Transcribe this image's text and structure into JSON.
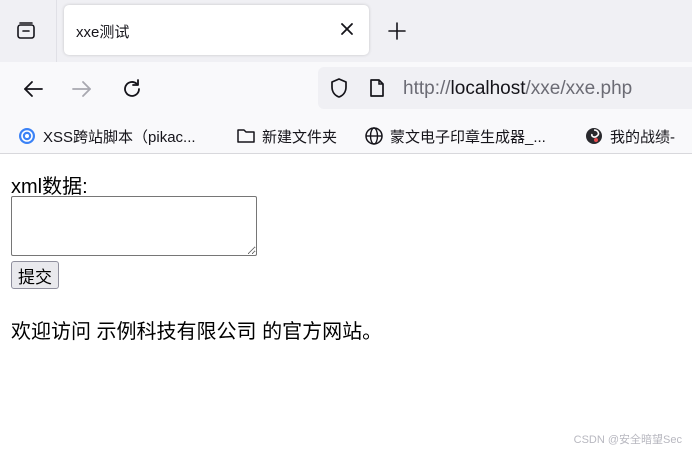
{
  "tab": {
    "title": "xxe测试"
  },
  "address": {
    "scheme": "http://",
    "host": "localhost",
    "path": "/xxe/xxe.php"
  },
  "bookmarks": [
    {
      "label": "XSS跨站脚本（pikac...",
      "icon": "xss-site-icon",
      "color": "#3b82f6"
    },
    {
      "label": "新建文件夹",
      "icon": "folder-icon"
    },
    {
      "label": "蒙文电子印章生成器_...",
      "icon": "globe-icon"
    },
    {
      "label": "我的战绩-",
      "icon": "spiral-site-icon"
    }
  ],
  "page": {
    "xml_label": "xml数据:",
    "submit_label": "提交",
    "welcome_text": "欢迎访问 示例科技有限公司 的官方网站。"
  },
  "watermark": "CSDN @安全暗望Sec",
  "colors": {
    "tabstrip_bg": "#f0f0f4",
    "toolbar_bg": "#f9f9fb",
    "urlbar_bg": "#f0f0f4",
    "text": "#15141a"
  }
}
